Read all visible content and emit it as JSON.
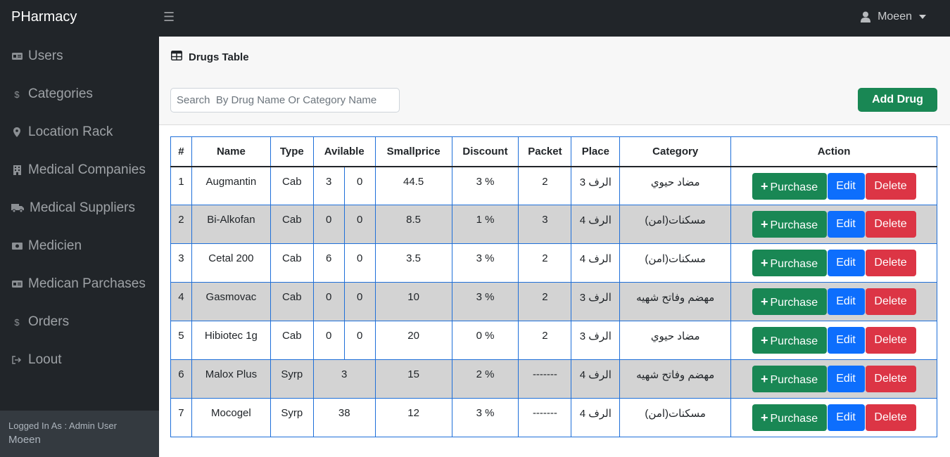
{
  "brand": "PHarmacy",
  "header": {
    "toggle_icon": "hamburger-icon",
    "user": "Moeen"
  },
  "sidebar": {
    "items": [
      {
        "label": "Users",
        "icon": "id-card-icon"
      },
      {
        "label": "Categories",
        "icon": "dollar-icon"
      },
      {
        "label": "Location Rack",
        "icon": "map-pin-icon"
      },
      {
        "label": "Medical Companies",
        "icon": "building-icon"
      },
      {
        "label": "Medical Suppliers",
        "icon": "truck-icon"
      },
      {
        "label": "Medicien",
        "icon": "money-bill-icon"
      },
      {
        "label": "Medican Parchases",
        "icon": "id-card-icon"
      },
      {
        "label": "Orders",
        "icon": "dollar-icon"
      },
      {
        "label": "Loout",
        "icon": "sign-out-icon"
      }
    ],
    "footer": {
      "logged_in_as": "Logged In As : Admin User",
      "name": "Moeen"
    }
  },
  "main": {
    "title": "Drugs Table",
    "search_placeholder": "Search  By Drug Name Or Category Name",
    "add_button": "Add Drug",
    "columns": [
      "#",
      "Name",
      "Type",
      "Avilable",
      "Smallprice",
      "Discount",
      "Packet",
      "Place",
      "Category",
      "Action"
    ],
    "actions": {
      "purchase": "Purchase",
      "edit": "Edit",
      "delete": "Delete"
    },
    "rows": [
      {
        "id": "1",
        "name": "Augmantin",
        "type": "Cab",
        "avail": [
          "3",
          "0"
        ],
        "smallprice": "44.5",
        "discount": "3 %",
        "packet": "2",
        "place": "الرف 3",
        "category": "مضاد حيوي"
      },
      {
        "id": "2",
        "name": "Bi-Alkofan",
        "type": "Cab",
        "avail": [
          "0",
          "0"
        ],
        "smallprice": "8.5",
        "discount": "1 %",
        "packet": "3",
        "place": "الرف 4",
        "category": "مسكنات(امن)"
      },
      {
        "id": "3",
        "name": "Cetal 200",
        "type": "Cab",
        "avail": [
          "6",
          "0"
        ],
        "smallprice": "3.5",
        "discount": "3 %",
        "packet": "2",
        "place": "الرف 4",
        "category": "مسكنات(امن)"
      },
      {
        "id": "4",
        "name": "Gasmovac",
        "type": "Cab",
        "avail": [
          "0",
          "0"
        ],
        "smallprice": "10",
        "discount": "3 %",
        "packet": "2",
        "place": "الرف 3",
        "category": "مهضم وفاتح شهيه"
      },
      {
        "id": "5",
        "name": "Hibiotec 1g",
        "type": "Cab",
        "avail": [
          "0",
          "0"
        ],
        "smallprice": "20",
        "discount": "0 %",
        "packet": "2",
        "place": "الرف 3",
        "category": "مضاد حيوي"
      },
      {
        "id": "6",
        "name": "Malox Plus",
        "type": "Syrp",
        "avail": [
          "3"
        ],
        "smallprice": "15",
        "discount": "2 %",
        "packet": "-------",
        "place": "الرف 4",
        "category": "مهضم وفاتح شهيه"
      },
      {
        "id": "7",
        "name": "Mocogel",
        "type": "Syrp",
        "avail": [
          "38"
        ],
        "smallprice": "12",
        "discount": "3 %",
        "packet": "-------",
        "place": "الرف 4",
        "category": "مسكنات(امن)"
      }
    ]
  },
  "colors": {
    "nav_bg": "#212529",
    "footer_bg": "#343a40",
    "success": "#198754",
    "primary": "#0d6efd",
    "danger": "#dc3545",
    "table_border": "#1e6fd9",
    "stripe": "#d3d3d3"
  }
}
